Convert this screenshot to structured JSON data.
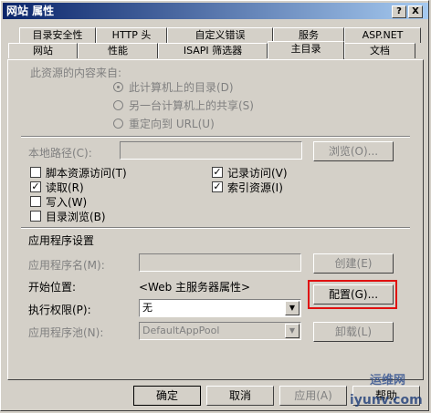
{
  "window": {
    "title": "网站 属性",
    "help_glyph": "?",
    "close_glyph": "X"
  },
  "tabs_row1": [
    "目录安全性",
    "HTTP 头",
    "自定义错误",
    "服务",
    "ASP.NET"
  ],
  "tabs_row2": [
    "网站",
    "性能",
    "ISAPI 筛选器",
    "主目录",
    "文档"
  ],
  "content_source": {
    "caption": "此资源的内容来自:",
    "options": [
      "此计算机上的目录(D)",
      "另一台计算机上的共享(S)",
      "重定向到 URL(U)"
    ],
    "selected_index": 0
  },
  "local_path": {
    "label": "本地路径(C):",
    "value": "",
    "browse_label": "浏览(O)..."
  },
  "permissions": [
    {
      "label": "脚本资源访问(T)",
      "checked": false
    },
    {
      "label": "读取(R)",
      "checked": true
    },
    {
      "label": "写入(W)",
      "checked": false
    },
    {
      "label": "目录浏览(B)",
      "checked": false
    }
  ],
  "logging": [
    {
      "label": "记录访问(V)",
      "checked": true
    },
    {
      "label": "索引资源(I)",
      "checked": true
    }
  ],
  "app_settings": {
    "section_title": "应用程序设置",
    "app_name_label": "应用程序名(M):",
    "app_name_value": "",
    "create_label": "创建(E)",
    "start_label": "开始位置:",
    "start_value": "<Web 主服务器属性>",
    "config_label": "配置(G)...",
    "exec_perm_label": "执行权限(P):",
    "exec_perm_value": "无",
    "pool_label": "应用程序池(N):",
    "pool_value": "DefaultAppPool",
    "unload_label": "卸载(L)"
  },
  "footer": {
    "ok": "确定",
    "cancel": "取消",
    "apply": "应用(A)",
    "help": "帮助"
  },
  "watermark": {
    "line1": "运维网",
    "line2": "iyunv.com"
  },
  "colors": {
    "title_start": "#0a246a",
    "title_end": "#a6caf0",
    "face": "#d4d0c8",
    "highlight": "#e01010"
  }
}
